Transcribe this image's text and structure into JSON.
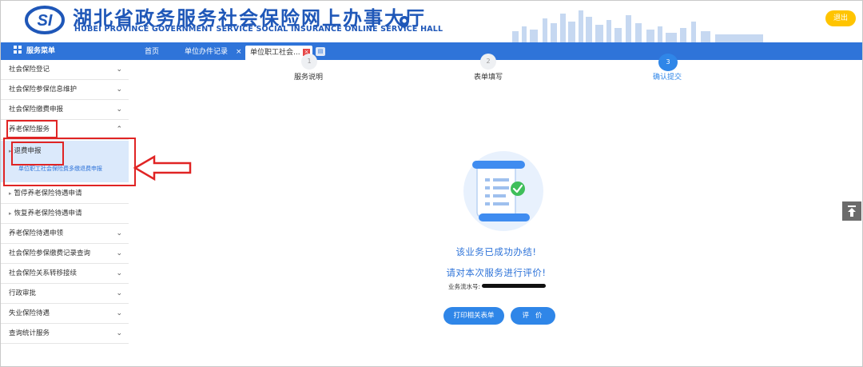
{
  "header": {
    "title_cn": "湖北省政务服务社会保险网上办事大厅",
    "title_en": "HUBEI PROVINCE GOVERNMENT SERVICE SOCIAL INSURANCE ONLINE SERVICE HALL",
    "logo_text": "SI",
    "logout_label": "退出",
    "icons": {
      "logo": "si-logo-icon",
      "location": "location-pin-icon",
      "skyline": "city-skyline-icon"
    }
  },
  "tabbar": {
    "menu_title": "服务菜单",
    "tabs": [
      {
        "label": "首页"
      },
      {
        "label": "单位办件记录",
        "close": "×"
      },
      {
        "label": "单位职工社会...",
        "close": "×"
      }
    ],
    "extra_tab_icon": "more-tabs-icon"
  },
  "sidebar": {
    "items": [
      {
        "label": "社会保险登记",
        "chevron": "down"
      },
      {
        "label": "社会保险参保信息维护",
        "chevron": "down"
      },
      {
        "label": "社会保险缴费申报",
        "chevron": "down"
      },
      {
        "label": "养老保险服务",
        "chevron": "up"
      }
    ],
    "active_group": {
      "label": "退费申报",
      "link": "单位职工社会保险费多缴退费申报"
    },
    "sub_items": [
      {
        "label": "暂停养老保险待遇申请"
      },
      {
        "label": "恢复养老保险待遇申请"
      }
    ],
    "more_items": [
      {
        "label": "养老保险待遇申领"
      },
      {
        "label": "社会保险参保缴费记录查询"
      },
      {
        "label": "社会保险关系转移接续"
      },
      {
        "label": "行政审批"
      },
      {
        "label": "失业保险待遇"
      },
      {
        "label": "查询统计服务"
      }
    ]
  },
  "steps": [
    {
      "number": "1",
      "label": "服务说明"
    },
    {
      "number": "2",
      "label": "表单填写"
    },
    {
      "number": "3",
      "label": "确认提交"
    }
  ],
  "result": {
    "message_1": "该业务已成功办结!",
    "message_2": "请对本次服务进行评价!",
    "serial_label": "业务流水号:",
    "print_button": "打印相关表单",
    "rate_button": "评价",
    "illustration_icon": "document-success-icon"
  },
  "colors": {
    "brand_blue": "#2f74d9",
    "accent_yellow": "#ffc400",
    "annotation_red": "#e02424"
  },
  "back_to_top_icon": "back-to-top-icon"
}
